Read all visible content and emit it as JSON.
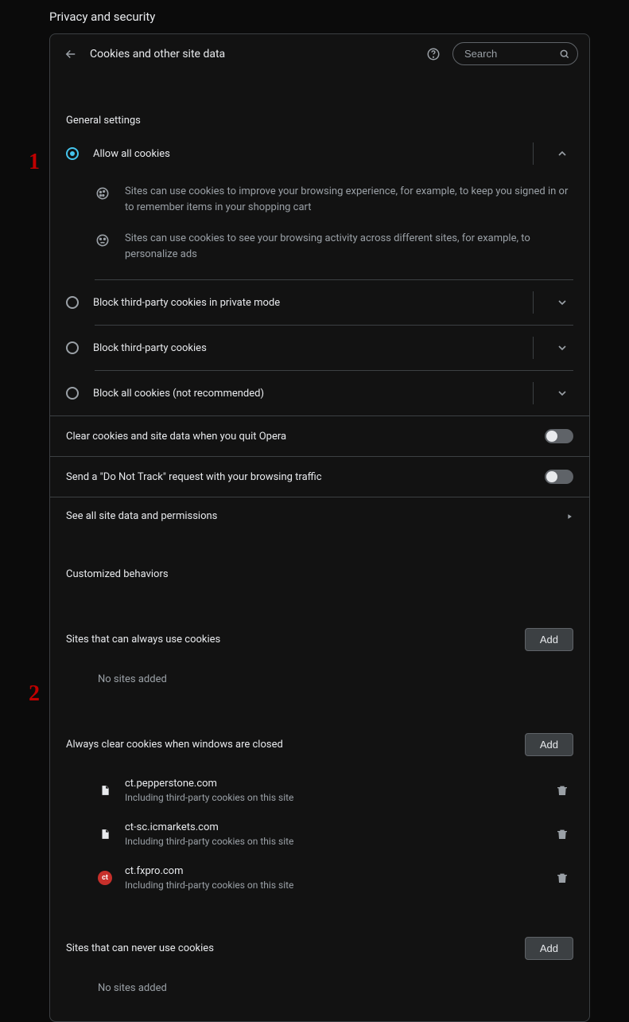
{
  "page_title": "Privacy and security",
  "header": {
    "title": "Cookies and other site data",
    "search_placeholder": "Search"
  },
  "general": {
    "label": "General settings",
    "options": [
      {
        "label": "Allow all cookies",
        "selected": true,
        "expanded": true
      },
      {
        "label": "Block third-party cookies in private mode",
        "selected": false,
        "expanded": false
      },
      {
        "label": "Block third-party cookies",
        "selected": false,
        "expanded": false
      },
      {
        "label": "Block all cookies (not recommended)",
        "selected": false,
        "expanded": false
      }
    ],
    "desc1": "Sites can use cookies to improve your browsing experience, for example, to keep you signed in or to remember items in your shopping cart",
    "desc2": "Sites can use cookies to see your browsing activity across different sites, for example, to personalize ads"
  },
  "toggles": {
    "clear_on_quit": "Clear cookies and site data when you quit Opera",
    "do_not_track": "Send a \"Do Not Track\" request with your browsing traffic"
  },
  "links": {
    "see_all": "See all site data and permissions"
  },
  "customized": {
    "label": "Customized behaviors",
    "always_use": {
      "label": "Sites that can always use cookies",
      "add": "Add",
      "empty": "No sites added"
    },
    "always_clear": {
      "label": "Always clear cookies when windows are closed",
      "add": "Add",
      "sites": [
        {
          "domain": "ct.pepperstone.com",
          "sub": "Including third-party cookies on this site",
          "icon": "page"
        },
        {
          "domain": "ct-sc.icmarkets.com",
          "sub": "Including third-party cookies on this site",
          "icon": "page"
        },
        {
          "domain": "ct.fxpro.com",
          "sub": "Including third-party cookies on this site",
          "icon": "round"
        }
      ]
    },
    "never_use": {
      "label": "Sites that can never use cookies",
      "add": "Add",
      "empty": "No sites added"
    }
  },
  "annotations": {
    "n1": "1",
    "n2": "2"
  }
}
